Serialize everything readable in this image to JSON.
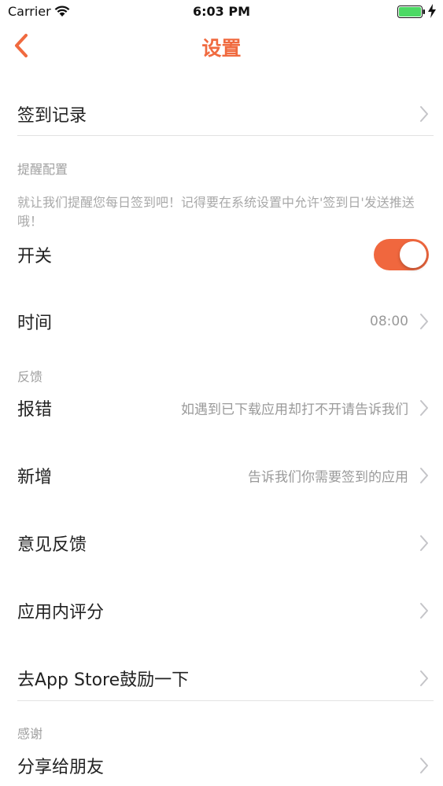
{
  "status_bar": {
    "carrier": "Carrier",
    "time": "6:03 PM"
  },
  "nav": {
    "title": "设置",
    "back_icon": "chevron-left-icon"
  },
  "rows": {
    "checkin_record": {
      "label": "签到记录"
    },
    "switch": {
      "label": "开关",
      "toggle_on": true
    },
    "time": {
      "label": "时间",
      "value": "08:00"
    },
    "report_error": {
      "label": "报错",
      "value": "如遇到已下载应用却打不开请告诉我们"
    },
    "add_new": {
      "label": "新增",
      "value": "告诉我们你需要签到的应用"
    },
    "feedback": {
      "label": "意见反馈"
    },
    "rate_in_app": {
      "label": "应用内评分"
    },
    "app_store": {
      "label": "去App Store鼓励一下"
    },
    "share": {
      "label": "分享给朋友"
    }
  },
  "sections": {
    "reminder": {
      "header": "提醒配置",
      "description": "就让我们提醒您每日签到吧！记得要在系统设置中允许'签到日'发送推送哦！"
    },
    "feedback": {
      "header": "反馈"
    },
    "thanks": {
      "header": "感谢"
    }
  },
  "colors": {
    "accent": "#f06a3f",
    "toggle_on": "#f0673e",
    "secondary_text": "#9a9a9a",
    "battery": "#4cd964"
  }
}
